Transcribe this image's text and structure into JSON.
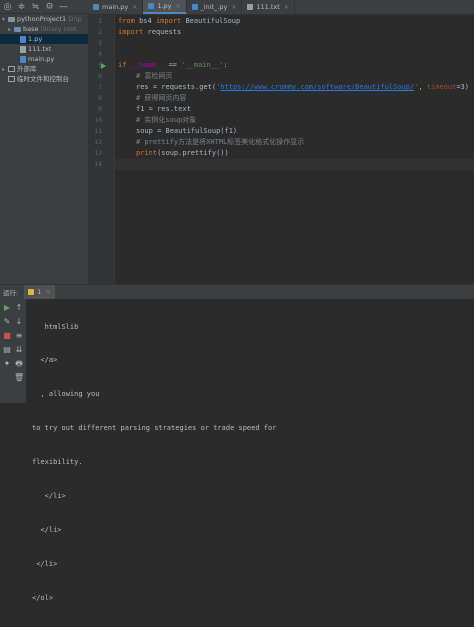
{
  "toolbar": {
    "icons": [
      "target-icon",
      "collapse-icon",
      "expand-icon",
      "gear-icon",
      "minimize-icon"
    ],
    "glyphs": [
      "◎",
      "≑",
      "≒",
      "⚙",
      "—"
    ]
  },
  "project_tree": {
    "root": {
      "name": "pythonProject1",
      "hint": "D:\\p"
    },
    "base": {
      "name": "base",
      "hint": "library root"
    },
    "files": [
      "1.py",
      "111.txt",
      "main.py"
    ],
    "external": "外部库",
    "scratch": "临时文件和控制台"
  },
  "tabs": [
    {
      "label": "main.py",
      "type": "py",
      "active": false
    },
    {
      "label": "1.py",
      "type": "py",
      "active": true
    },
    {
      "label": "_init_.py",
      "type": "py",
      "active": false
    },
    {
      "label": "111.txt",
      "type": "txt",
      "active": false
    }
  ],
  "editor": {
    "line_numbers": [
      "1",
      "2",
      "3",
      "4",
      "5",
      "6",
      "7",
      "8",
      "9",
      "10",
      "11",
      "12",
      "13",
      "14"
    ],
    "code": {
      "l1_from": "from",
      "l1_mod": " bs4 ",
      "l1_import": "import",
      "l1_cls": " BeautifulSoup",
      "l2_import": "import",
      "l2_mod": " requests",
      "l5_if": "if",
      "l5_name": " __name__",
      "l5_eq": " == ",
      "l5_main": "'__main__'",
      "l5_colon": ":",
      "l6_comment": "# 富检网页",
      "l7_pre": "res = requests.get(",
      "l7_q1": "'",
      "l7_url": "https://www.crummy.com/software/BeautifulSoup/",
      "l7_q2": "'",
      "l7_comma": ", ",
      "l7_param": "timeout",
      "l7_post": "=3)",
      "l8_comment": "# 获得网页内容",
      "l9": "f1 = res.text",
      "l10_comment": "# 实例化soup对象",
      "l11": "soup = BeautifulSoup(f1)",
      "l12_comment": "# prettify方法是将XHTML标签美化格式化操作显示",
      "l13_print": "print",
      "l13_rest": "(soup.prettify())"
    }
  },
  "run_panel": {
    "label": "运行:",
    "tab": "1",
    "output": [
      "   htmlSlib",
      "  </a>",
      "  , allowing you",
      "to try out different parsing strategies or trade speed for",
      "flexibility.",
      "   </li>",
      "  </li>",
      " </li>",
      "</ol>"
    ]
  },
  "side_tools": {
    "glyphs": [
      "▶",
      "↑",
      "↓",
      "≡",
      "⇊",
      "🖶",
      "🗑"
    ]
  },
  "colors": {
    "keyword": "#cc7832",
    "string": "#6a8759",
    "comment": "#808080",
    "url": "#287bde",
    "dunder": "#b200b2",
    "run_green": "#59a869"
  }
}
